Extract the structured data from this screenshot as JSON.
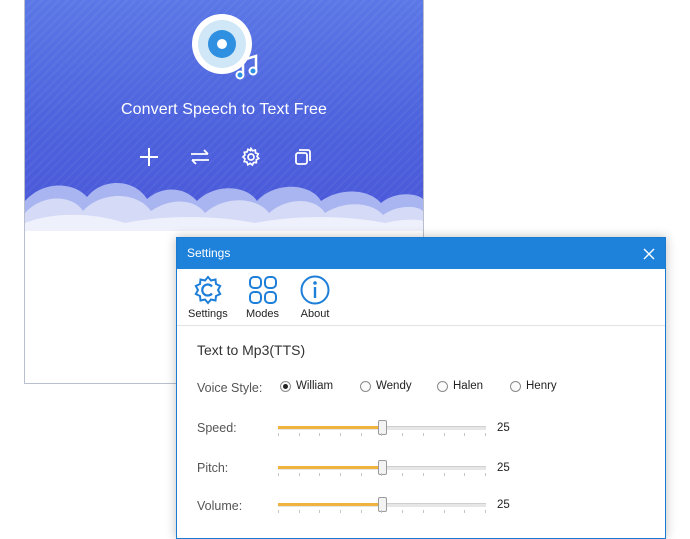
{
  "app": {
    "tagline": "Convert Speech to Text Free",
    "toolbar": [
      {
        "icon": "plus-icon"
      },
      {
        "icon": "swap-arrows-icon"
      },
      {
        "icon": "gear-icon"
      },
      {
        "icon": "copy-window-icon"
      }
    ]
  },
  "colors": {
    "hero_top": "#5b78e6",
    "hero_bottom": "#4a57d8",
    "dialog_title": "#1e82da",
    "icon_blue": "#1e7fd8",
    "slider_fill": "#f0b340"
  },
  "settings_dialog": {
    "title": "Settings",
    "close_icon": "close-icon",
    "toolbar": [
      {
        "label": "Settings",
        "icon": "settings-gear-icon"
      },
      {
        "label": "Modes",
        "icon": "modes-grid-icon"
      },
      {
        "label": "About",
        "icon": "info-icon"
      }
    ],
    "section_title": "Text to Mp3(TTS)",
    "voice_style": {
      "label": "Voice Style:",
      "options": [
        "William",
        "Wendy",
        "Halen",
        "Henry"
      ],
      "selected": "William"
    },
    "sliders": [
      {
        "label": "Speed:",
        "value": "25",
        "fraction": 0.5
      },
      {
        "label": "Pitch:",
        "value": "25",
        "fraction": 0.5
      },
      {
        "label": "Volume:",
        "value": "25",
        "fraction": 0.5
      }
    ]
  }
}
